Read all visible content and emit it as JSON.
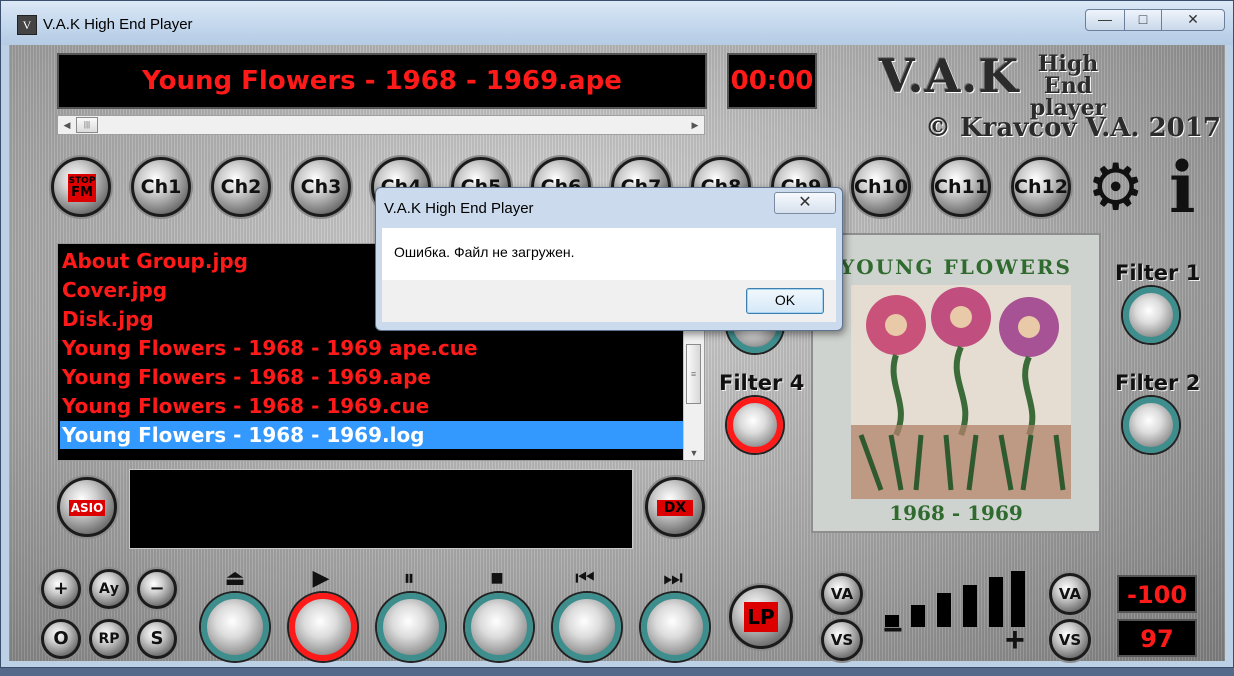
{
  "window": {
    "title": "V.A.K High End Player",
    "minimize_label": "—",
    "maximize_label": "□",
    "close_label": "✕",
    "app_icon_letter": "V"
  },
  "display": {
    "track_title": "Young Flowers - 1968 - 1969.ape",
    "time": "00:00"
  },
  "logo": {
    "name": "V.A.K",
    "sub_line1": "High End",
    "sub_line2": "player",
    "copyright": "© Kravcov V.A. 2017"
  },
  "stop_fm": {
    "line1": "STOP",
    "line2": "FM"
  },
  "channels": [
    "Ch1",
    "Ch2",
    "Ch3",
    "Ch4",
    "Ch5",
    "Ch6",
    "Ch7",
    "Ch8",
    "Ch9",
    "Ch10",
    "Ch11",
    "Ch12"
  ],
  "files": [
    "About Group.jpg",
    "Cover.jpg",
    "Disk.jpg",
    "Young Flowers - 1968 - 1969 ape.cue",
    "Young Flowers - 1968 - 1969.ape",
    "Young Flowers - 1968 - 1969.cue",
    "Young Flowers - 1968 - 1969.log"
  ],
  "selected_file_index": 6,
  "output_buttons": {
    "asio": "ASIO",
    "dx": "DX"
  },
  "album": {
    "title": "YOUNG FLOWERS",
    "years": "1968 - 1969"
  },
  "filters": {
    "f1": "Filter 1",
    "f2": "Filter 2",
    "f4": "Filter 4"
  },
  "small_buttons": {
    "plus": "+",
    "ay": "Aу",
    "minus": "−",
    "o": "O",
    "rp": "RP",
    "s": "S"
  },
  "transport": {
    "eject": "⏏",
    "play": "▶",
    "pause": "⏸",
    "stop": "■",
    "prev": "⏮",
    "next": "⏭"
  },
  "lp_label": "LP",
  "va_label": "VA",
  "vs_label": "VS",
  "volume": {
    "minus": "−",
    "plus": "+",
    "level": 6,
    "bars": 6
  },
  "readouts": {
    "top": "-100",
    "bottom": "97"
  },
  "dialog": {
    "title": "V.A.K High End Player",
    "message": "Ошибка. Файл не загружен.",
    "ok": "OK",
    "close": "✕"
  },
  "colors": {
    "lcd_red": "#ff1a1a",
    "selection_blue": "#3399ff",
    "knob_teal": "#3f8e8e"
  }
}
